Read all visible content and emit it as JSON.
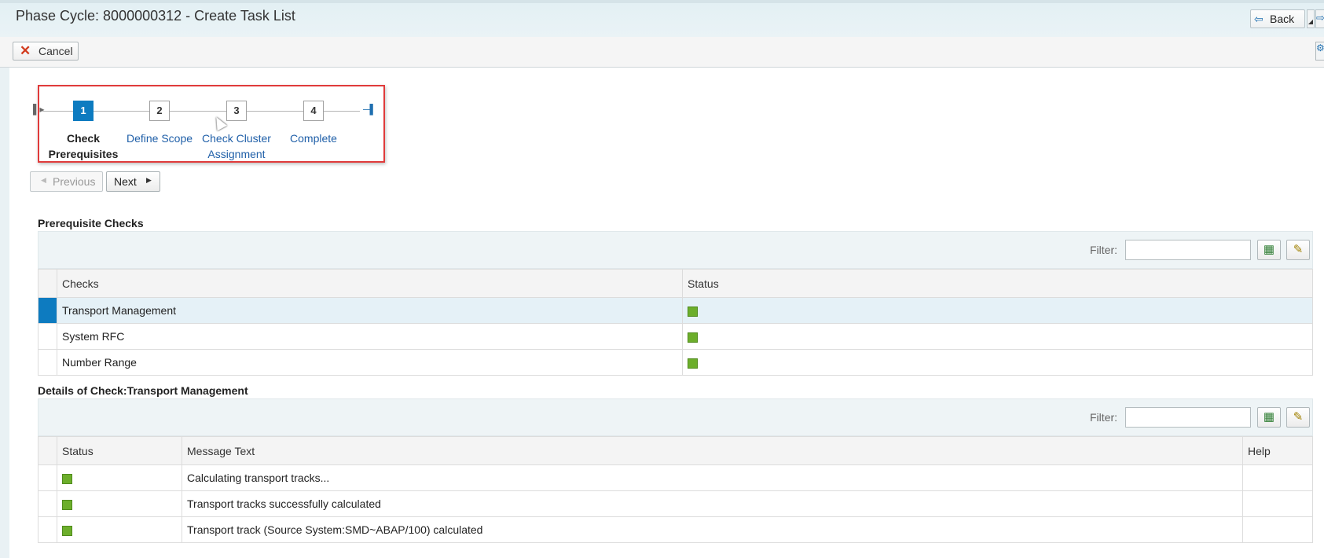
{
  "header": {
    "title": "Phase Cycle: 8000000312 - Create Task List",
    "back_label": "Back"
  },
  "toolbar": {
    "cancel_label": "Cancel"
  },
  "roadmap": {
    "steps": [
      {
        "number": "1",
        "label": "Check Prerequisites",
        "active": true
      },
      {
        "number": "2",
        "label": "Define Scope",
        "active": false
      },
      {
        "number": "3",
        "label": "Check Cluster Assignment",
        "active": false
      },
      {
        "number": "4",
        "label": "Complete",
        "active": false
      }
    ]
  },
  "navigation": {
    "previous_label": "Previous",
    "next_label": "Next"
  },
  "prereq": {
    "title": "Prerequisite Checks",
    "filter_label": "Filter:",
    "filter_value": "",
    "columns": [
      "Checks",
      "Status"
    ],
    "rows": [
      {
        "check": "Transport Management",
        "status": "green",
        "selected": true
      },
      {
        "check": "System RFC",
        "status": "green",
        "selected": false
      },
      {
        "check": "Number Range",
        "status": "green",
        "selected": false
      }
    ]
  },
  "details": {
    "title": "Details of Check:Transport Management",
    "filter_label": "Filter:",
    "filter_value": "",
    "columns": [
      "Status",
      "Message Text",
      "Help"
    ],
    "rows": [
      {
        "status": "green",
        "message": "Calculating transport tracks...",
        "help": ""
      },
      {
        "status": "green",
        "message": "Transport tracks successfully calculated",
        "help": ""
      },
      {
        "status": "green",
        "message": "Transport track (Source System:SMD~ABAP/100) calculated",
        "help": ""
      }
    ]
  },
  "colors": {
    "accent": "#0d7bc0",
    "status_ok": "#6cae2b",
    "highlight_border": "#e03b3b"
  }
}
